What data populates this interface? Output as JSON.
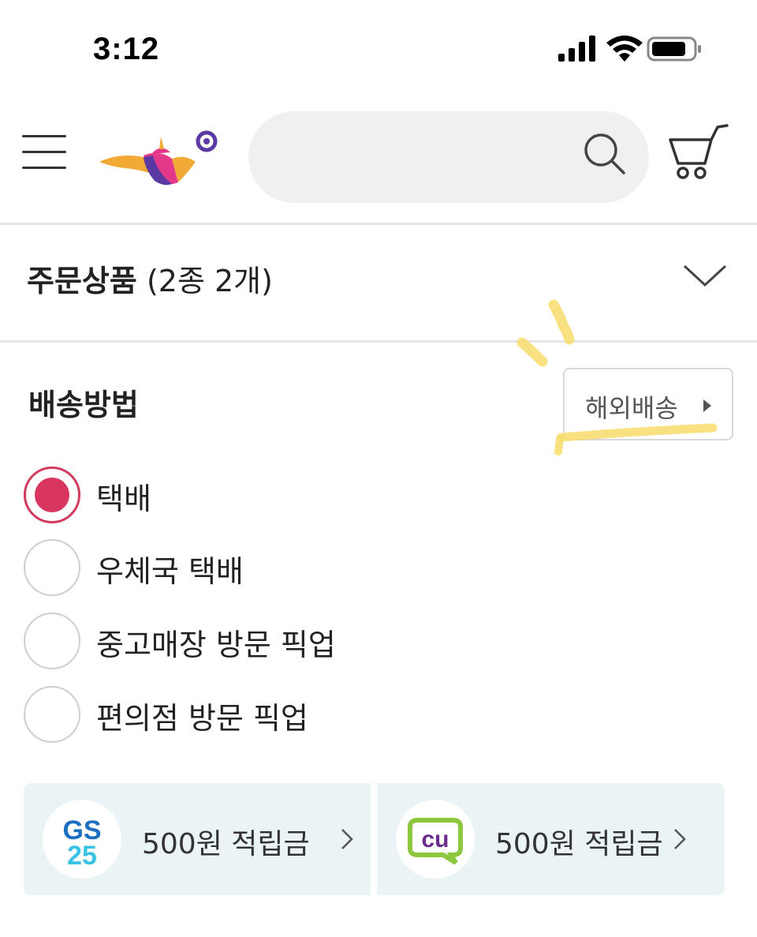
{
  "status_bar": {
    "time": "3:12",
    "icons": [
      "signal-icon",
      "wifi-icon",
      "battery-icon"
    ]
  },
  "header": {
    "logo": "aladin-lamp-logo",
    "search": {
      "value": "",
      "placeholder": ""
    },
    "icons": [
      "menu-icon",
      "search-icon",
      "cart-icon"
    ]
  },
  "order": {
    "title": "주문상품",
    "count": "(2종 2개)"
  },
  "delivery": {
    "title": "배송방법",
    "overseas_button": "해외배송",
    "options": [
      {
        "label": "택배",
        "checked": true
      },
      {
        "label": "우체국 택배",
        "checked": false
      },
      {
        "label": "중고매장 방문 픽업",
        "checked": false
      },
      {
        "label": "편의점 방문 픽업",
        "checked": false
      }
    ]
  },
  "stores": [
    {
      "name": "GS25",
      "logo_line1": "GS",
      "logo_line2": "25",
      "text": "500원 적립금"
    },
    {
      "name": "CU",
      "logo_text": "cu",
      "text": "500원 적립금"
    }
  ],
  "colors": {
    "accent": "#d8365f",
    "store_bg": "#eaf4f7",
    "search_bg": "#f0f0f0",
    "highlight": "#f8dc6c",
    "gs_blue": "#1d6fc1",
    "gs_cyan": "#39c1e6",
    "cu_purple": "#6a2c8f",
    "cu_green": "#8dc63f"
  }
}
